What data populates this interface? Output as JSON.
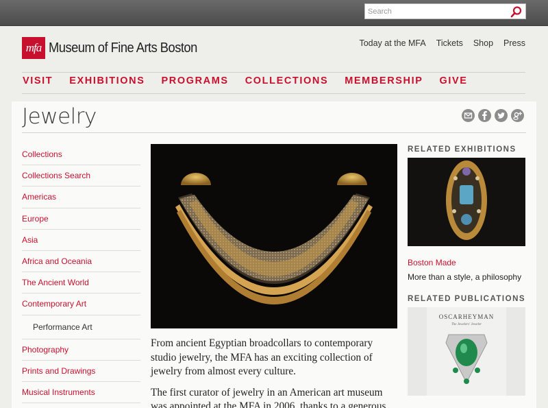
{
  "search": {
    "placeholder": "Search"
  },
  "brand": {
    "logo_mark": "mfa",
    "name": "Museum of Fine Arts Boston"
  },
  "utility_nav": [
    "Today at the MFA",
    "Tickets",
    "Shop",
    "Press"
  ],
  "main_nav": [
    "VISIT",
    "EXHIBITIONS",
    "PROGRAMS",
    "COLLECTIONS",
    "MEMBERSHIP",
    "GIVE"
  ],
  "page": {
    "title": "Jewelry"
  },
  "share_icons": [
    "email-icon",
    "facebook-icon",
    "twitter-icon",
    "google-plus-icon"
  ],
  "sidebar": {
    "items": [
      {
        "label": "Collections"
      },
      {
        "label": "Collections Search"
      },
      {
        "label": "Americas"
      },
      {
        "label": "Europe"
      },
      {
        "label": "Asia"
      },
      {
        "label": "Africa and Oceania"
      },
      {
        "label": "The Ancient World"
      },
      {
        "label": "Contemporary Art"
      },
      {
        "label": "Performance Art"
      },
      {
        "label": "Photography"
      },
      {
        "label": "Prints and Drawings"
      },
      {
        "label": "Musical Instruments"
      }
    ]
  },
  "main": {
    "paragraphs": [
      "From ancient Egyptian broadcollars to contemporary studio jewelry, the MFA has an exciting collection of jewelry from almost every culture.",
      "The first curator of jewelry in an American art museum was appointed at the MFA in 2006, thanks to a generous"
    ]
  },
  "related_exhibitions": {
    "heading": "RELATED EXHIBITIONS",
    "title": "Boston Made",
    "subtitle": "More than a style, a philosophy"
  },
  "related_publications": {
    "heading": "RELATED PUBLICATIONS",
    "book_title": "OSCARHEYMAN",
    "book_subtitle": "The Jewelers' Jeweler"
  },
  "colors": {
    "accent": "#c8102e",
    "topbar": "#555555",
    "background": "#eeeeea"
  }
}
